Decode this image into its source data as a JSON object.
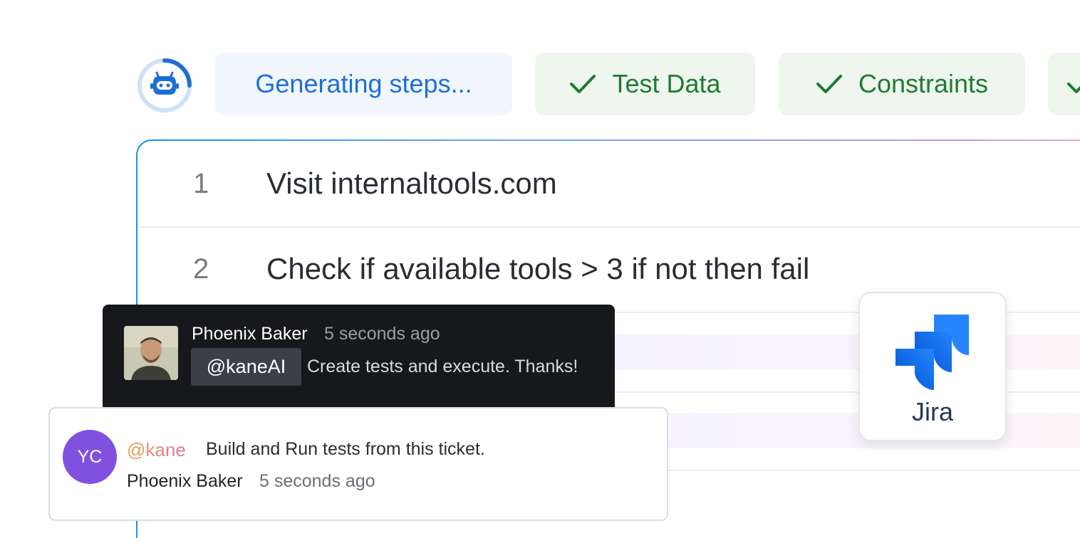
{
  "status_row": {
    "generating_label": "Generating steps...",
    "test_data_label": "Test Data",
    "constraints_label": "Constraints"
  },
  "steps": [
    {
      "number": "1",
      "text": "Visit internaltools.com"
    },
    {
      "number": "2",
      "text": "Check if available tools > 3 if not then fail"
    }
  ],
  "dark_comment": {
    "author": "Phoenix Baker",
    "time": "5 seconds ago",
    "mention": "@kaneAI",
    "message": "Create tests and execute. Thanks!"
  },
  "light_comment": {
    "avatar_initials": "YC",
    "mention": "@kane",
    "message": "Build and Run tests from this ticket.",
    "author": "Phoenix Baker",
    "time": "5 seconds ago"
  },
  "integration": {
    "name": "Jira",
    "icon": "jira-icon"
  },
  "colors": {
    "accent_blue": "#1d6fd6",
    "success_green": "#1f7a33",
    "avatar_purple": "#8250df",
    "jira_blue": "#2684ff"
  }
}
